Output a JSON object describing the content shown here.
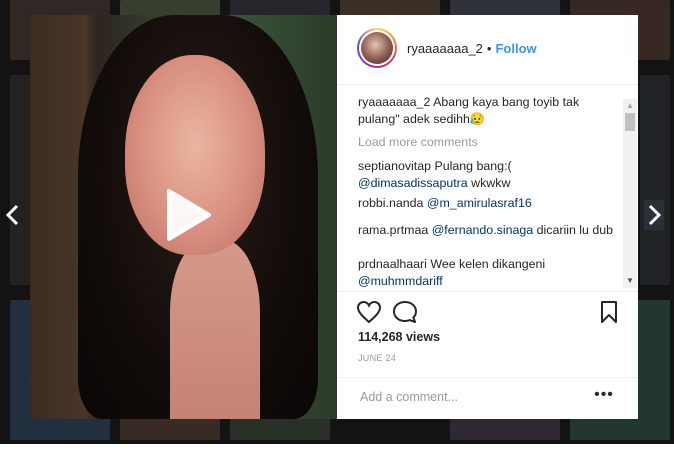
{
  "post": {
    "username": "ryaaaaaaa_2",
    "follow_label": "Follow",
    "separator": "•"
  },
  "caption": {
    "username": "ryaaaaaaa_2",
    "text": "Abang kaya bang toyib tak pulang\" adek sedihh😥"
  },
  "load_more_label": "Load more comments",
  "comments": [
    {
      "username": "septianovitap",
      "text": "Pulang bang:(",
      "mention": "@dimasadissaputra",
      "after": "wkwkw"
    },
    {
      "username": "robbi.nanda",
      "text": "",
      "mention": "@m_amirulasraf16",
      "after": ""
    },
    {
      "username": "rama.prtmaa",
      "text": "",
      "mention": "@fernando.sinaga",
      "after": "dicariin lu dub"
    },
    {
      "username": "prdnaalhaari",
      "text": "Wee kelen dikangeni",
      "mention": "@muhmmdariff",
      "after": ""
    }
  ],
  "views": "114,268 views",
  "date": "JUNE 24",
  "add_comment_placeholder": "Add a comment...",
  "more_label": "•••",
  "colors": {
    "link_blue": "#3897f0",
    "mention": "#003569",
    "text": "#262626",
    "muted": "#999999"
  },
  "icons": {
    "like": "heart-icon",
    "comment": "comment-icon",
    "save": "bookmark-icon",
    "play": "play-icon",
    "prev": "chevron-left-icon",
    "next": "chevron-right-icon"
  }
}
